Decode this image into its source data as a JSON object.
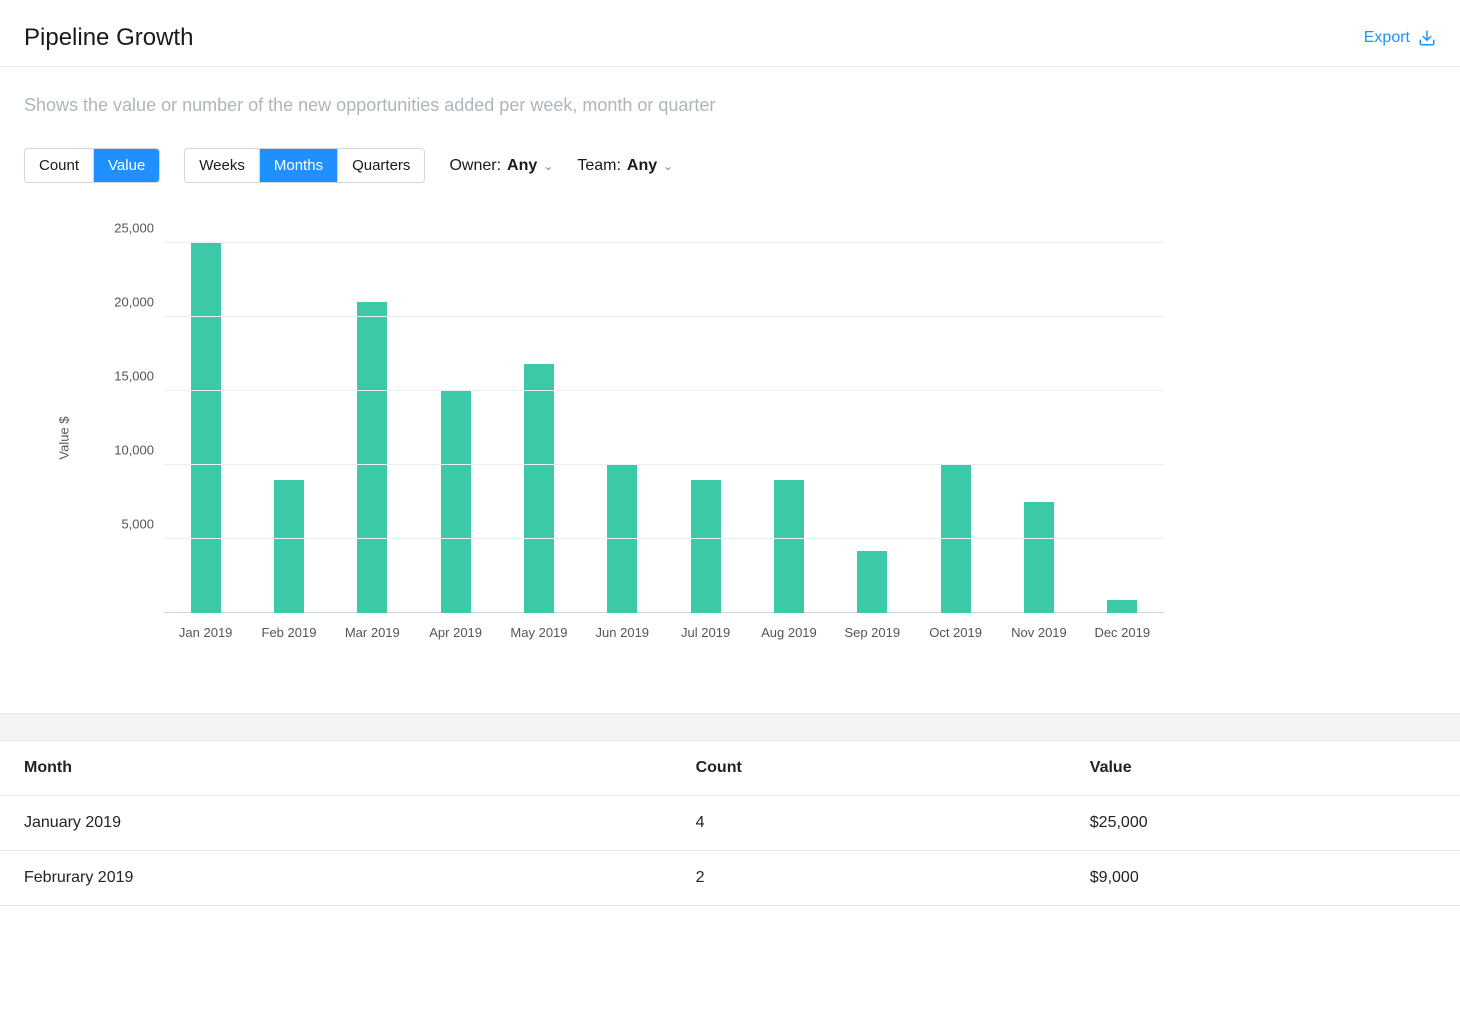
{
  "header": {
    "title": "Pipeline Growth",
    "export_label": "Export"
  },
  "description": "Shows the value or number of the new opportunities added per week, month or quarter",
  "controls": {
    "metric": {
      "options": [
        "Count",
        "Value"
      ],
      "selected": "Value"
    },
    "period": {
      "options": [
        "Weeks",
        "Months",
        "Quarters"
      ],
      "selected": "Months"
    },
    "owner": {
      "label": "Owner:",
      "value": "Any"
    },
    "team": {
      "label": "Team:",
      "value": "Any"
    }
  },
  "chart_data": {
    "type": "bar",
    "ylabel": "Value $",
    "ylim": [
      0,
      25000
    ],
    "yticks": [
      5000,
      10000,
      15000,
      20000,
      25000
    ],
    "ytick_labels": [
      "5,000",
      "10,000",
      "15,000",
      "20,000",
      "25,000"
    ],
    "categories": [
      "Jan 2019",
      "Feb 2019",
      "Mar 2019",
      "Apr 2019",
      "May 2019",
      "Jun 2019",
      "Jul 2019",
      "Aug 2019",
      "Sep 2019",
      "Oct 2019",
      "Nov 2019",
      "Dec 2019"
    ],
    "values": [
      25000,
      9000,
      21000,
      15000,
      16800,
      10000,
      9000,
      9000,
      4200,
      10000,
      7500,
      900
    ],
    "bar_color": "#3cc9a7"
  },
  "table": {
    "headers": [
      "Month",
      "Count",
      "Value"
    ],
    "rows": [
      {
        "month": "January 2019",
        "count": "4",
        "value": "$25,000"
      },
      {
        "month": "Februrary 2019",
        "count": "2",
        "value": "$9,000"
      }
    ]
  }
}
